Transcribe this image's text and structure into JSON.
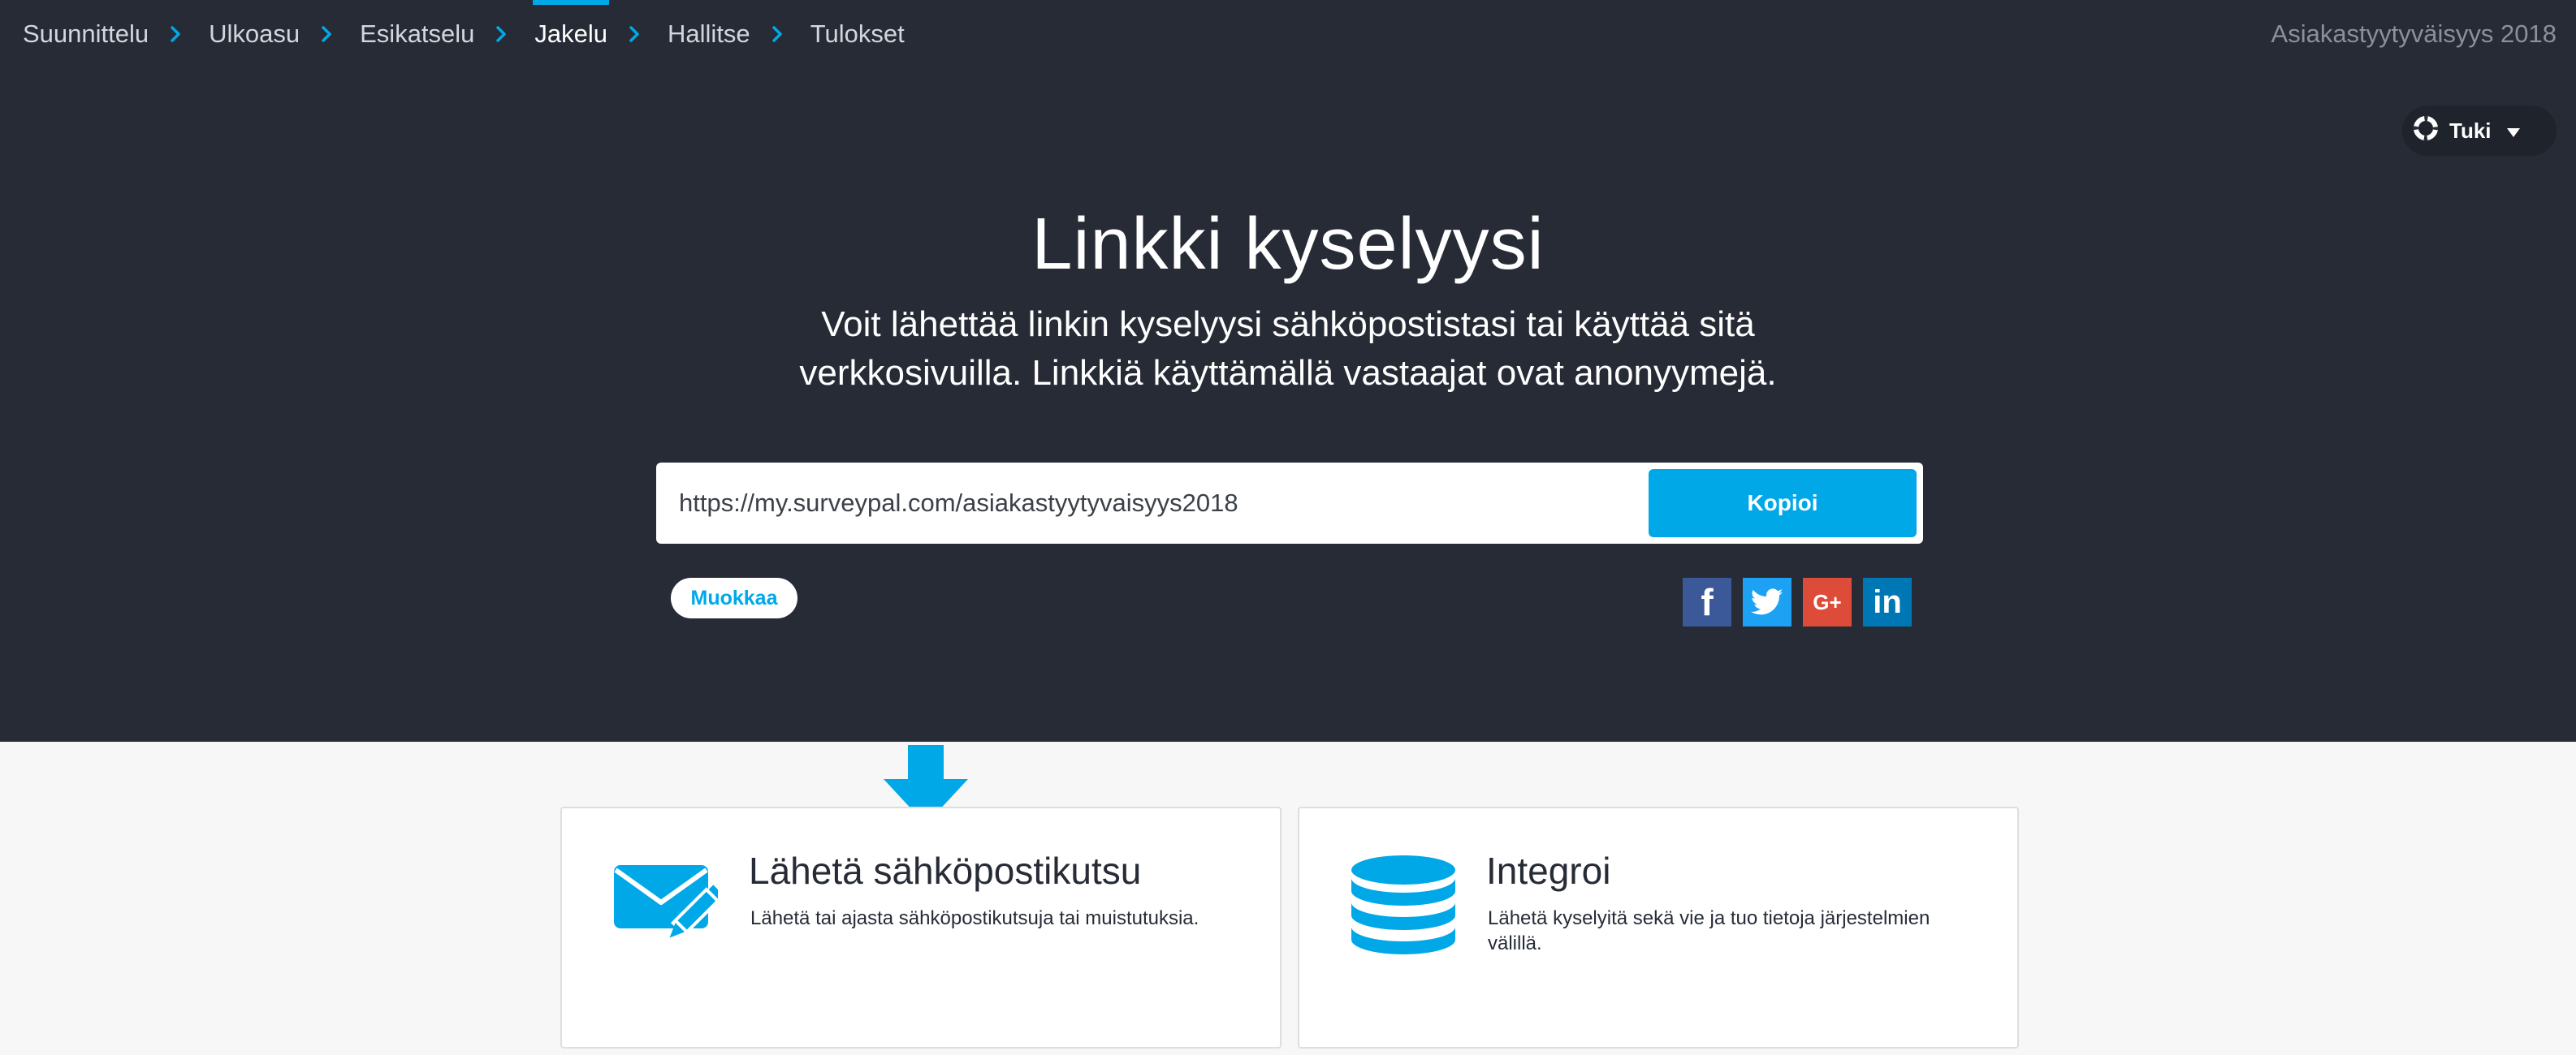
{
  "nav": {
    "steps": [
      "Suunnittelu",
      "Ulkoasu",
      "Esikatselu",
      "Jakelu",
      "Hallitse",
      "Tulokset"
    ],
    "active": "Jakelu",
    "survey_name": "Asiakastyytyväisyys 2018"
  },
  "help": {
    "label": "Tuki"
  },
  "hero": {
    "title": "Linkki kyselyysi",
    "description": "Voit lähettää linkin kyselyysi sähköpostistasi tai käyttää sitä verkkosivuilla. Linkkiä käyttämällä vastaajat ovat anonyymejä.",
    "link_value": "https://my.surveypal.com/asiakastyytyvaisyys2018",
    "copy_label": "Kopioi",
    "edit_label": "Muokkaa"
  },
  "social": [
    {
      "name": "facebook",
      "icon": "facebook-icon",
      "color": "#3b5998",
      "glyph": "f"
    },
    {
      "name": "twitter",
      "icon": "twitter-icon",
      "color": "#1da1f2",
      "glyph": ""
    },
    {
      "name": "google-plus",
      "icon": "google-plus-icon",
      "color": "#dd4b39",
      "glyph": "G+"
    },
    {
      "name": "linkedin",
      "icon": "linkedin-icon",
      "color": "#0077b5",
      "glyph": "in"
    }
  ],
  "cards": [
    {
      "title": "Lähetä sähköpostikutsu",
      "description": "Lähetä tai ajasta sähköpostikutsuja tai muistutuksia.",
      "icon": "envelope-pencil-icon"
    },
    {
      "title": "Integroi",
      "description": "Lähetä kyselyitä sekä vie ja tuo tietoja järjestelmien välillä.",
      "icon": "database-icon"
    }
  ],
  "colors": {
    "accent": "#00a8e8",
    "dark_bg": "#262b36",
    "page_bg": "#f7f7f7"
  }
}
